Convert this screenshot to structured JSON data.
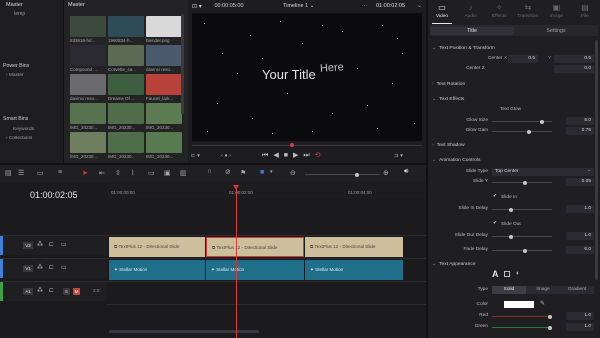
{
  "colors": {
    "accent": "#e03b3b",
    "blue": "#3f7fd9",
    "playhead": "#d63a3a",
    "title_clip": "#cdbf9c",
    "motion_clip": "#1f6f8a"
  },
  "media": {
    "master_label": "Master",
    "sub_label": "temp",
    "header_label": "Master",
    "thumbs": [
      {
        "label": "833618-hd...",
        "color": "#3b4a3c"
      },
      {
        "label": "1990834-h...",
        "color": "#2f4b57"
      },
      {
        "label": "blender.png",
        "color": "#d9d9d9"
      },
      {
        "label": "Compound ...",
        "color": "#2a2a30"
      },
      {
        "label": "Corvette_sa...",
        "color": "#5a6a55"
      },
      {
        "label": "davinci reso...",
        "color": "#4c5a6e"
      },
      {
        "label": "davinci reso...",
        "color": "#6a6a6f"
      },
      {
        "label": "Dreams Of ...",
        "color": "#3e5e42"
      },
      {
        "label": "Faucet_lark...",
        "color": "#b8433a"
      },
      {
        "label": "IMG_20230...",
        "color": "#57724e"
      },
      {
        "label": "IMG_20230...",
        "color": "#4f6d49"
      },
      {
        "label": "IMG_20230...",
        "color": "#5b7b52"
      },
      {
        "label": "IMG_20230...",
        "color": "#6d7f5e"
      },
      {
        "label": "IMG_20230...",
        "color": "#4e6e4a"
      },
      {
        "label": "IMG_20230...",
        "color": "#587a50"
      }
    ],
    "power_bins": "Power Bins",
    "power_master": "Master",
    "smart_bins": "Smart Bins",
    "keywords": "Keywords",
    "collections": "Collections"
  },
  "viewer": {
    "tc_left": "00:00:05:00",
    "timeline_name": "Timeline 1",
    "tc_right": "01:00:02:05",
    "title_text": "Your Title",
    "here_text": "Here"
  },
  "timeline": {
    "timecode": "01:00:02:05",
    "ruler": [
      "01:00:00:00",
      "01:00:02:00",
      "01:00:04:00"
    ],
    "tracks": [
      {
        "name": "V2",
        "kind": "video"
      },
      {
        "name": "V1",
        "kind": "video"
      },
      {
        "name": "A1",
        "kind": "audio",
        "level": "2.0"
      }
    ],
    "v2_clips": [
      "TextPlus 12 - Directional Slide",
      "TextPlus 12 - Directional Slide",
      "TextPlus 12 - Directional Slide"
    ],
    "v1_clips": [
      "Stellar Motion",
      "Stellar Motion",
      "Stellar Motion"
    ]
  },
  "inspector": {
    "tabs": [
      {
        "label": "Video",
        "active": true
      },
      {
        "label": "Audio",
        "active": false
      },
      {
        "label": "Effects",
        "active": false
      },
      {
        "label": "Transition",
        "active": false
      },
      {
        "label": "Image",
        "active": false
      },
      {
        "label": "File",
        "active": false
      }
    ],
    "subtabs": [
      "Title",
      "Settings"
    ],
    "sections": {
      "text_pos": "Text Position & Transform",
      "text_rot": "Text Rotation",
      "text_fx": "Text Effects",
      "text_shadow": "Text Shadow",
      "anim": "Animation Controls",
      "appearance": "Text Appearance"
    },
    "center_label": "Center",
    "x_label": "X",
    "y_label": "Y",
    "center_x": "0.5",
    "center_y": "0.5",
    "center_z_label": "Center Z",
    "center_z": "0.0",
    "text_glow": "Text Glow",
    "glow_size_label": "Glow Size",
    "glow_size": "8.0",
    "glow_size_pct": 0.85,
    "glow_gain_label": "Glow Gain",
    "glow_gain": "0.75",
    "glow_gain_pct": 0.62,
    "slide_type_label": "Slide Type",
    "slide_type": "Top Center",
    "slide_y_label": "Slide Y",
    "slide_y": "0.05",
    "slide_y_pct": 0.55,
    "slide_in": "Slide In",
    "slide_in_delay_label": "Slide In Delay",
    "slide_in_delay": "1.0",
    "slide_in_delay_pct": 0.3,
    "slide_out": "Slide Out",
    "slide_out_delay_label": "Slide Out Delay",
    "slide_out_delay": "1.0",
    "slide_out_delay_pct": 0.3,
    "fade_delay_label": "Fade Delay",
    "fade_delay": "6.0",
    "fade_delay_pct": 0.55,
    "type_label": "Type",
    "type_options": [
      "Solid",
      "Image",
      "Gradient"
    ],
    "color_label": "Color",
    "red_label": "Red",
    "red": "1.0",
    "green_label": "Green",
    "green": "1.0"
  }
}
